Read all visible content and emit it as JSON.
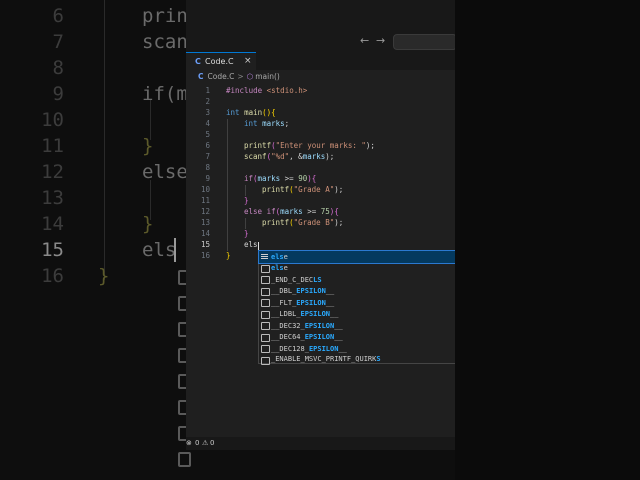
{
  "background_editor": {
    "line_numbers": [
      "6",
      "7",
      "8",
      "9",
      "10",
      "11",
      "12",
      "13",
      "14",
      "15",
      "16"
    ],
    "lines": [
      "printf",
      "scanf",
      "",
      "if(ma",
      "",
      "}",
      "else",
      "",
      "}",
      "els",
      "}"
    ]
  },
  "window": {
    "nav": {
      "back": "←",
      "forward": "→"
    },
    "tab": {
      "icon": "C",
      "name": "Code.C",
      "close": "×"
    },
    "breadcrumb": {
      "file_icon": "C",
      "file": "Code.C",
      "separator": ">",
      "symbol_icon": "⬡",
      "symbol": "main()"
    },
    "line_numbers": [
      "1",
      "2",
      "3",
      "4",
      "5",
      "6",
      "7",
      "8",
      "9",
      "10",
      "11",
      "12",
      "13",
      "14",
      "15",
      "16"
    ],
    "active_line": "15",
    "code": {
      "l1_directive": "#include",
      "l1_header": " <stdio.h>",
      "l3_type": "int",
      "l3_func": "main",
      "l3_paren": "()",
      "l3_brace": "{",
      "l4_type": "int",
      "l4_var": "marks",
      "l4_semi": ";",
      "l6_func": "printf",
      "l6_open": "(",
      "l6_str": "\"Enter your marks: \"",
      "l6_close": ");",
      "l7_func": "scanf",
      "l7_open": "(",
      "l7_str": "\"%d\"",
      "l7_mid": ", &",
      "l7_var": "marks",
      "l7_close": ");",
      "l9_kw": "if",
      "l9_open": "(",
      "l9_var": "marks",
      "l9_op": " >= ",
      "l9_num": "90",
      "l9_close": ")",
      "l9_brace": "{",
      "l10_func": "printf",
      "l10_open": "(",
      "l10_str": "\"Grade A\"",
      "l10_close": ");",
      "l11_brace": "}",
      "l12_kw1": "else",
      "l12_kw2": "if",
      "l12_open": "(",
      "l12_var": "marks",
      "l12_op": " >= ",
      "l12_num": "75",
      "l12_close": ")",
      "l12_brace": "{",
      "l13_func": "printf",
      "l13_open": "(",
      "l13_str": "\"Grade B\"",
      "l13_close": ");",
      "l14_brace": "}",
      "l15_text": "els",
      "l16_brace": "}"
    },
    "suggestions": [
      {
        "match": "els",
        "rest": "e",
        "kind": "keyword",
        "selected": true
      },
      {
        "match": "els",
        "rest": "e",
        "kind": "snippet",
        "selected": false
      },
      {
        "pre": "_END_C_DEC",
        "match": "LS",
        "rest": "",
        "kind": "snippet",
        "selected": false
      },
      {
        "pre": "__DBL_",
        "match": "EPSILON",
        "rest": "__",
        "kind": "snippet",
        "selected": false
      },
      {
        "pre": "__FLT_",
        "match": "EPSILON",
        "rest": "__",
        "kind": "snippet",
        "selected": false
      },
      {
        "pre": "__LDBL_",
        "match": "EPSILON",
        "rest": "__",
        "kind": "snippet",
        "selected": false
      },
      {
        "pre": "__DEC32_",
        "match": "EPSILON",
        "rest": "__",
        "kind": "snippet",
        "selected": false
      },
      {
        "pre": "__DEC64_",
        "match": "EPSILON",
        "rest": "__",
        "kind": "snippet",
        "selected": false
      },
      {
        "pre": "__DEC128_",
        "match": "EPSILON",
        "rest": "__",
        "kind": "snippet",
        "selected": false
      },
      {
        "pre": "_ENABLE_MSVC_PRINTF_QUIRK",
        "match": "S",
        "rest": "",
        "kind": "snippet",
        "selected": false
      }
    ],
    "status": {
      "errors": "0",
      "warnings": "0",
      "error_icon": "⊗",
      "warning_icon": "⚠"
    }
  }
}
